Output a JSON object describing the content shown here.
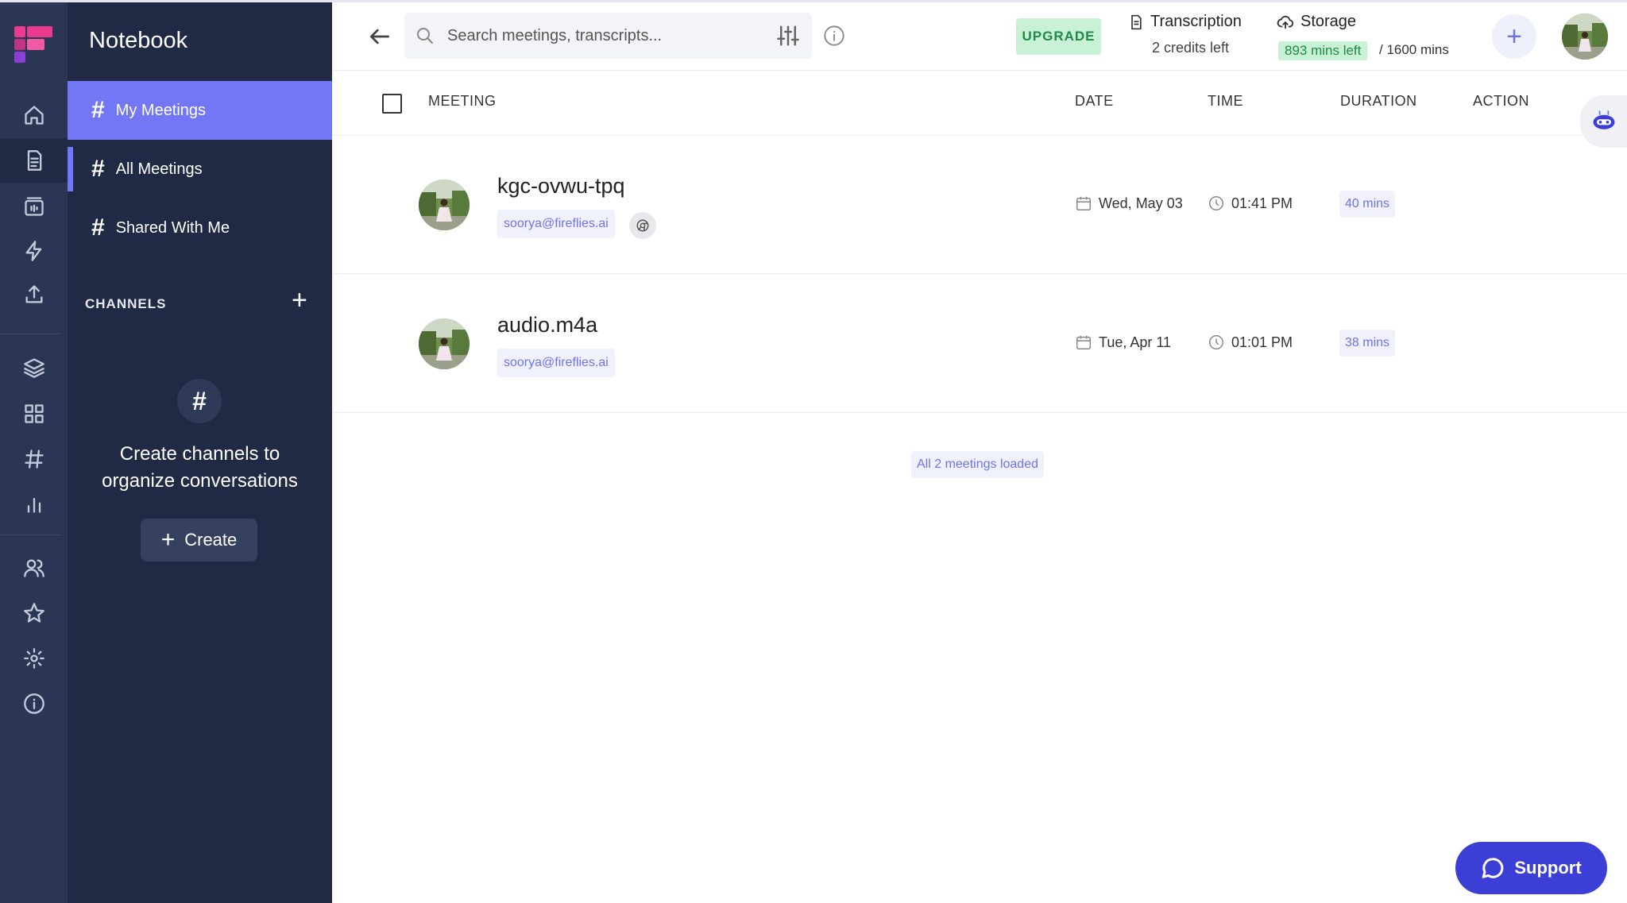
{
  "sidebar": {
    "title": "Notebook",
    "nav": [
      {
        "label": "My Meetings",
        "active": true
      },
      {
        "label": "All Meetings",
        "active": false
      },
      {
        "label": "Shared With Me",
        "active": false
      }
    ],
    "channels_label": "CHANNELS",
    "empty_channels_text": "Create channels to organize conversations",
    "create_label": "Create"
  },
  "rail": {
    "icons": [
      "home-icon",
      "notebook-icon",
      "calendar-icon",
      "bolt-icon",
      "upload-icon",
      "layers-icon",
      "apps-icon",
      "hash-icon",
      "analytics-icon",
      "team-icon",
      "star-icon",
      "settings-icon",
      "info-icon"
    ]
  },
  "header": {
    "search_placeholder": "Search meetings, transcripts...",
    "upgrade_label": "UPGRADE",
    "transcription_label": "Transcription",
    "credits_left": "2 credits left",
    "storage_label": "Storage",
    "storage_left": "893 mins left",
    "storage_total": "/ 1600 mins"
  },
  "table": {
    "columns": [
      "MEETING",
      "DATE",
      "TIME",
      "DURATION",
      "ACTION"
    ],
    "rows": [
      {
        "title": "kgc-ovwu-tpq",
        "email": "soorya@fireflies.ai",
        "date": "Wed, May 03",
        "time": "01:41 PM",
        "duration": "40 mins",
        "source_icon": "chrome-icon"
      },
      {
        "title": "audio.m4a",
        "email": "soorya@fireflies.ai",
        "date": "Tue, Apr 11",
        "time": "01:01 PM",
        "duration": "38 mins"
      }
    ],
    "footer": "All 2 meetings loaded"
  },
  "support_label": "Support",
  "colors": {
    "rail_bg": "#2b3654",
    "panel_bg": "#202a44",
    "accent": "#7377f5",
    "green_badge": "#c8f1d6",
    "support_bg": "#3b3fd6"
  }
}
